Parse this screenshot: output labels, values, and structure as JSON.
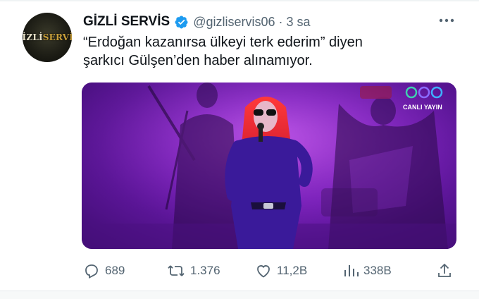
{
  "account": {
    "avatar_text_main": "GİZLİ",
    "avatar_text_accent": "SERVİS",
    "display_name": "GİZLİ SERVİS",
    "handle": "@gizliservis06",
    "separator": "·",
    "timestamp": "3 sa"
  },
  "tweet": {
    "line1": "“Erdoğan kazanırsa ülkeyi terk ederim” diyen",
    "line2": "şarkıcı Gülşen’den haber alınamıyor."
  },
  "media": {
    "watermark_label": "CANLI YAYIN",
    "watermark_logo": "ööö"
  },
  "actions": {
    "replies": "689",
    "retweets": "1.376",
    "likes": "11,2B",
    "views": "338B"
  },
  "colors": {
    "verified_blue": "#1d9bf0",
    "muted_text": "#536471",
    "stage_purple": "#7f22c0"
  },
  "icons": [
    "verified-badge-icon",
    "more-options-icon",
    "reply-icon",
    "retweet-icon",
    "like-icon",
    "views-icon",
    "share-icon"
  ]
}
